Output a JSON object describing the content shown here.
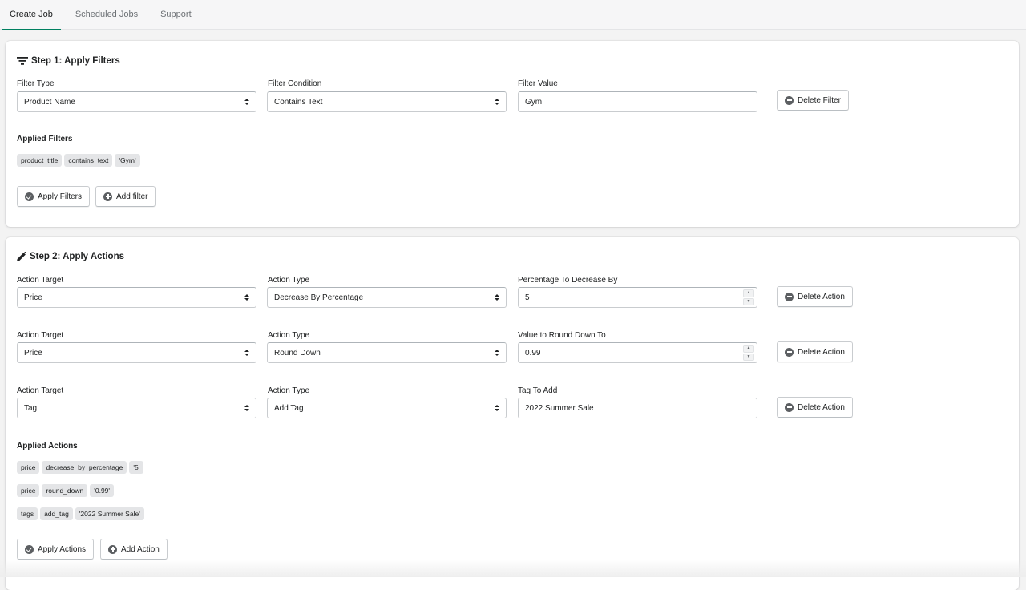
{
  "tabs": [
    {
      "label": "Create Job",
      "active": true
    },
    {
      "label": "Scheduled Jobs",
      "active": false
    },
    {
      "label": "Support",
      "active": false
    }
  ],
  "step1": {
    "title": "Step 1: Apply Filters",
    "filter": {
      "type_label": "Filter Type",
      "type_value": "Product Name",
      "condition_label": "Filter Condition",
      "condition_value": "Contains Text",
      "value_label": "Filter Value",
      "value_value": "Gym",
      "delete_label": "Delete Filter"
    },
    "applied_label": "Applied Filters",
    "applied": [
      "product_title",
      "contains_text",
      "'Gym'"
    ],
    "apply_button": "Apply Filters",
    "add_button": "Add filter"
  },
  "step2": {
    "title": "Step 2: Apply Actions",
    "actions": [
      {
        "target_label": "Action Target",
        "target_value": "Price",
        "type_label": "Action Type",
        "type_value": "Decrease By Percentage",
        "value_label": "Percentage To Decrease By",
        "value_value": "5",
        "delete_label": "Delete Action"
      },
      {
        "target_label": "Action Target",
        "target_value": "Price",
        "type_label": "Action Type",
        "type_value": "Round Down",
        "value_label": "Value to Round Down To",
        "value_value": "0.99",
        "delete_label": "Delete Action"
      },
      {
        "target_label": "Action Target",
        "target_value": "Tag",
        "type_label": "Action Type",
        "type_value": "Add Tag",
        "value_label": "Tag To Add",
        "value_value": "2022 Summer Sale",
        "delete_label": "Delete Action"
      }
    ],
    "applied_label": "Applied Actions",
    "applied": [
      [
        "price",
        "decrease_by_percentage",
        "'5'"
      ],
      [
        "price",
        "round_down",
        "'0.99'"
      ],
      [
        "tags",
        "add_tag",
        "'2022 Summer Sale'"
      ]
    ],
    "apply_button": "Apply Actions",
    "add_button": "Add Action"
  },
  "colors": {
    "accent": "#008060",
    "icon": "#5c5f62",
    "chip": "#e4e5e7"
  }
}
